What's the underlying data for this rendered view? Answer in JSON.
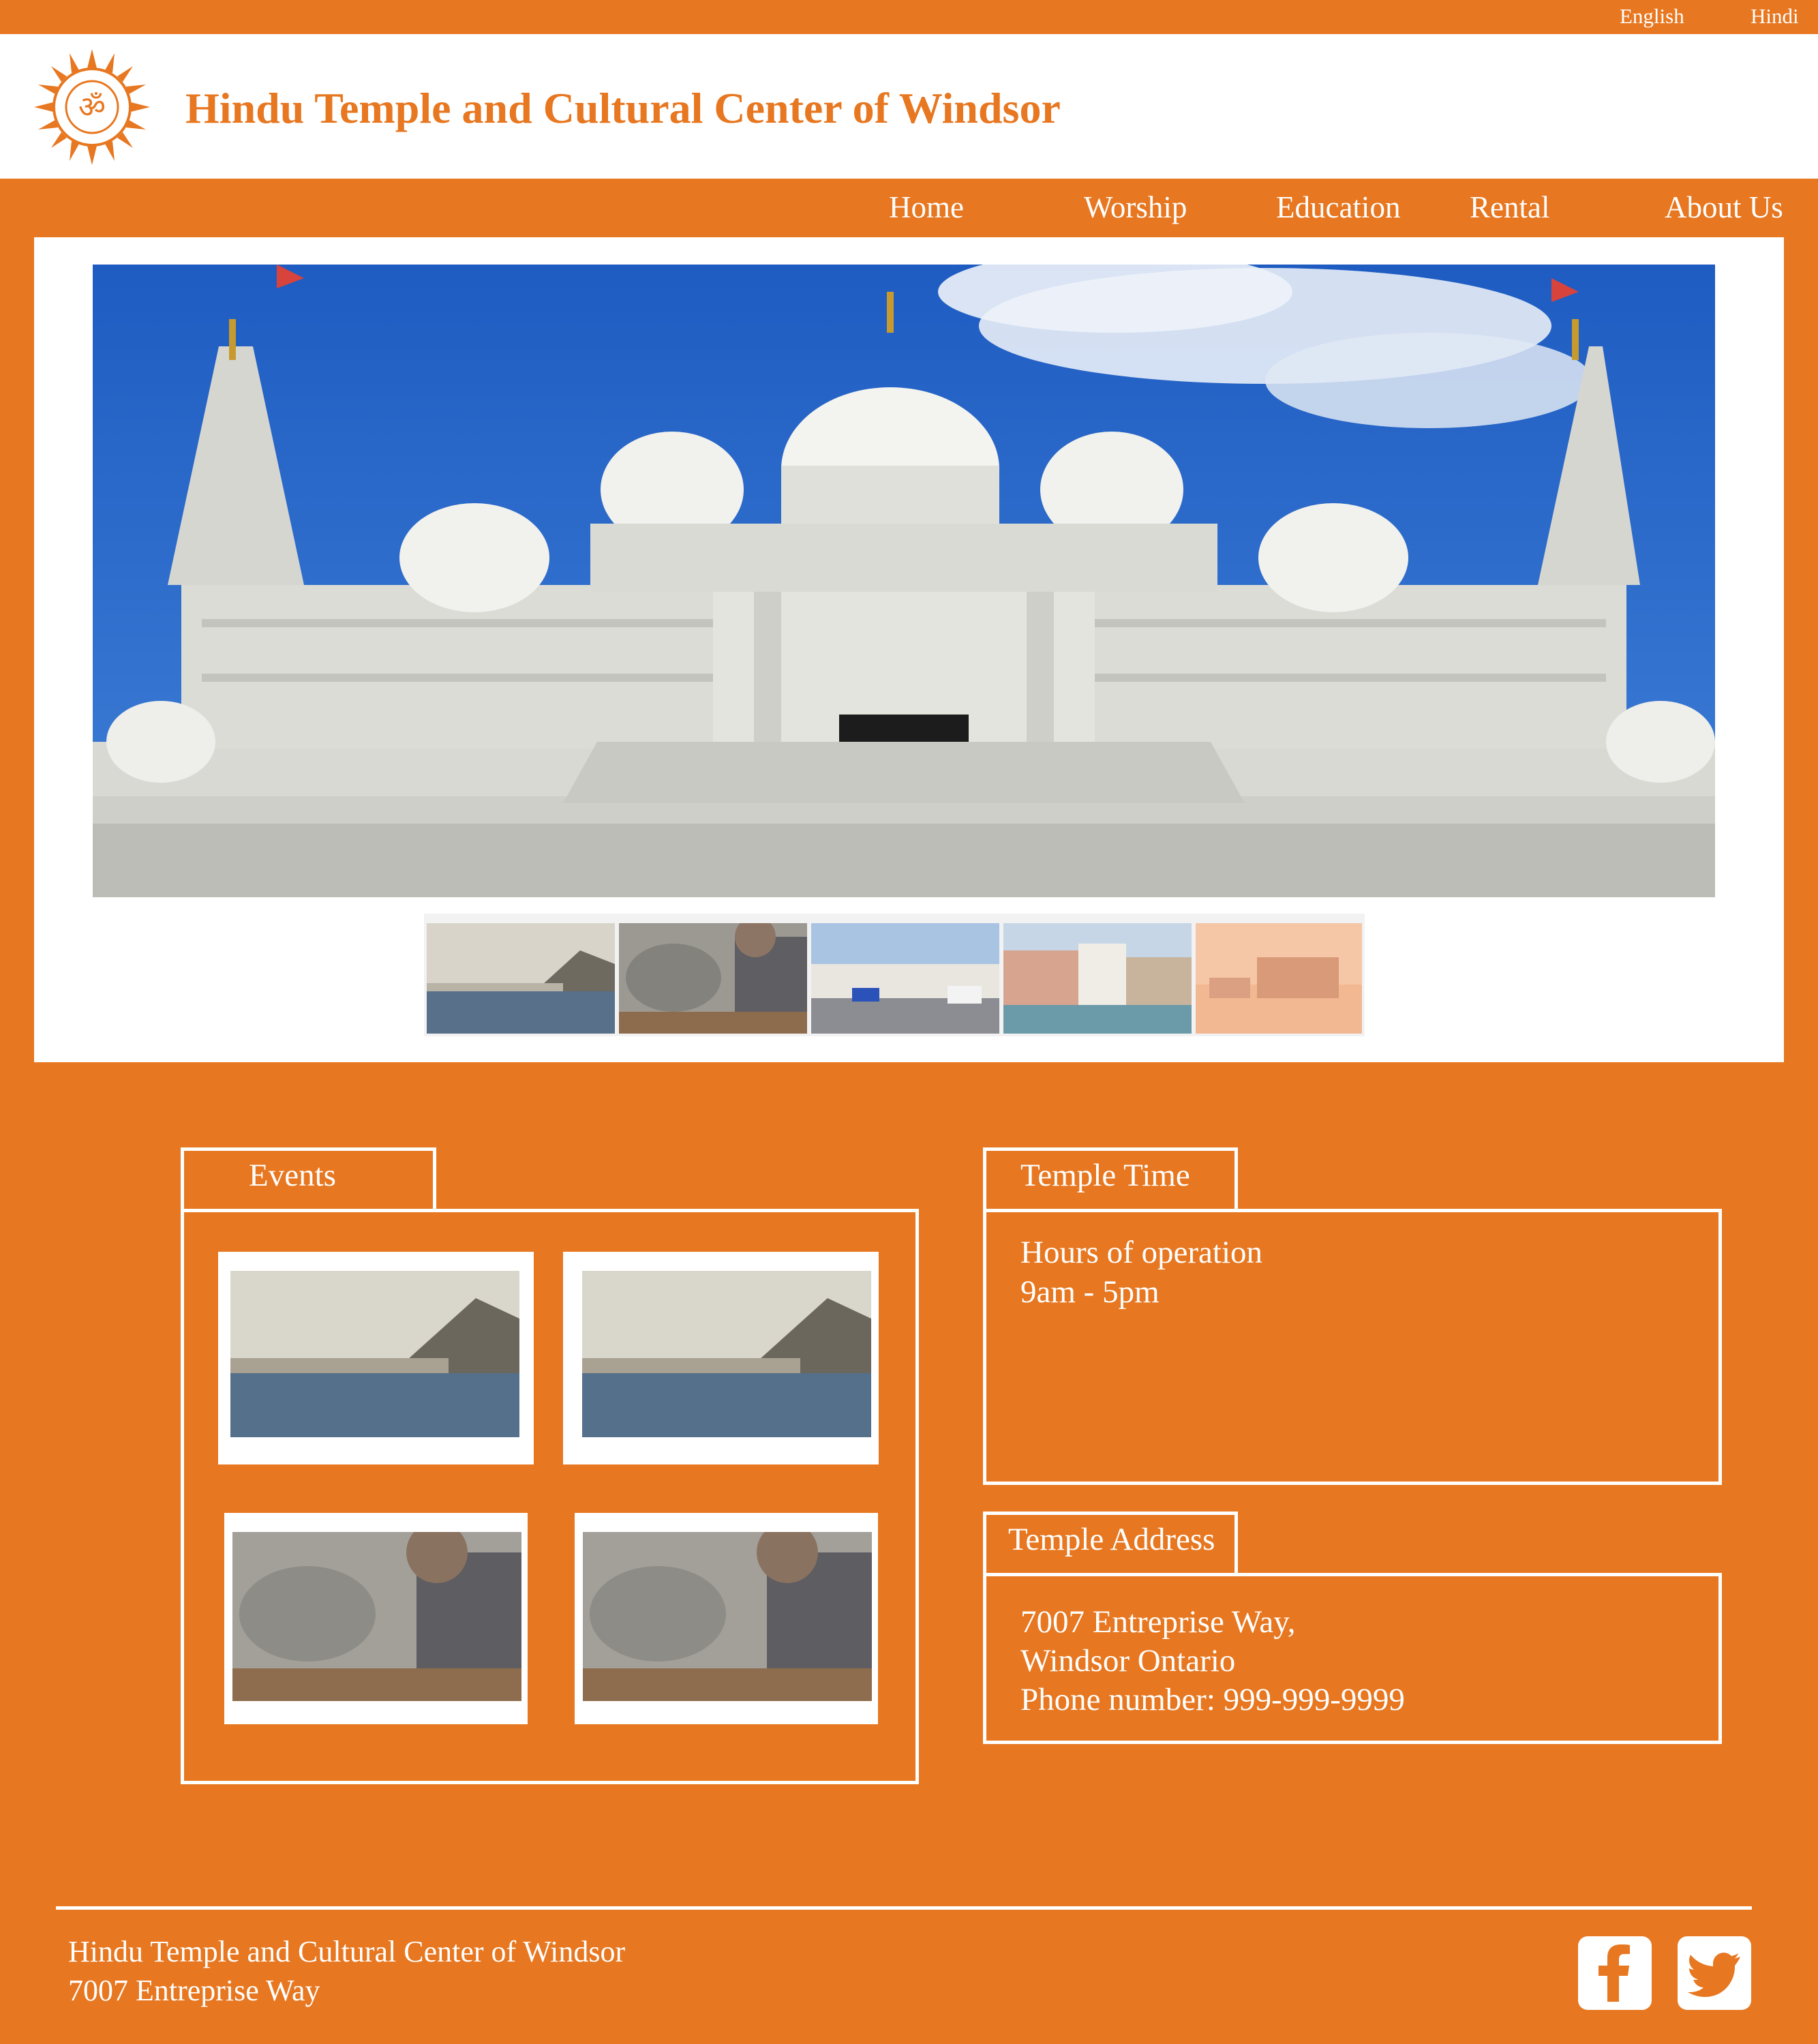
{
  "language_bar": {
    "english": "English",
    "hindi": "Hindi"
  },
  "header": {
    "title": "Hindu Temple and Cultural Center of Windsor"
  },
  "nav": {
    "home": "Home",
    "worship": "Worship",
    "education": "Education",
    "rental": "Rental",
    "about": "About Us"
  },
  "events": {
    "tab_label": "Events"
  },
  "temple_time": {
    "tab_label": "Temple Time",
    "line1": "Hours of operation",
    "line2": "9am - 5pm"
  },
  "temple_address": {
    "tab_label": "Temple Address",
    "line1": "7007 Entreprise Way,",
    "line2": "Windsor Ontario",
    "line3": "Phone number: 999-999-9999"
  },
  "footer": {
    "line1": "Hindu Temple and Cultural Center of Windsor",
    "line2": "7007 Entreprise Way"
  },
  "colors": {
    "brand_orange": "#e77720",
    "white": "#ffffff"
  },
  "icons": {
    "logo": "om-sun-logo-icon",
    "facebook": "facebook-icon",
    "twitter": "twitter-icon"
  }
}
